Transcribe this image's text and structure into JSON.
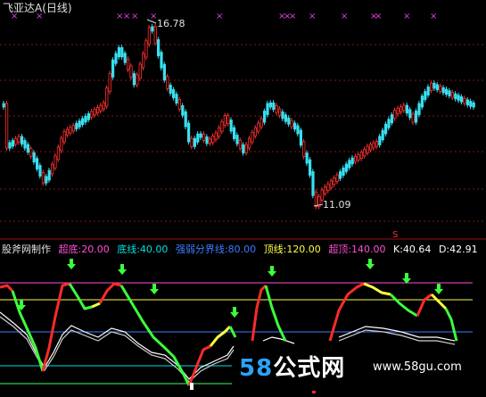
{
  "header": {
    "title": "飞亚达A",
    "period": "(日线)"
  },
  "price_panel": {
    "high_label": "16.78",
    "low_label": "11.09",
    "top_mark": "×"
  },
  "indicator": {
    "name": "股斧网制作",
    "items": [
      {
        "label": "超底:20.00",
        "color": "#ff4fd8"
      },
      {
        "label": "底线:40.00",
        "color": "#00e0e0"
      },
      {
        "label": "强弱分界线:80.00",
        "color": "#3b7bff"
      },
      {
        "label": "顶线:120.00",
        "color": "#ffff40"
      },
      {
        "label": "超顶:140.00",
        "color": "#ff4fd8"
      },
      {
        "label": "K:40.64",
        "color": "#ffffff"
      },
      {
        "label": "D:42.91",
        "color": "#ffffff"
      }
    ]
  },
  "watermark": {
    "logo_num": "58",
    "logo_text": "公式网",
    "url": "www.58gu.com"
  },
  "colors": {
    "up": "#ff3030",
    "down": "#38e0f0",
    "green_arrow": "#3cff3c"
  }
}
